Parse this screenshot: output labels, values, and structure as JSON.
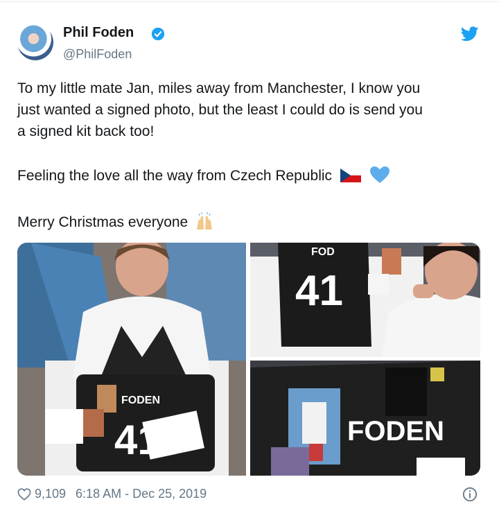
{
  "tweet": {
    "author_name": "Phil Foden",
    "author_handle": "@PhilFoden",
    "text_line_1": "To my little mate Jan, miles away from Manchester, I know you",
    "text_line_2": "just wanted a signed photo, but the least I could do is send you",
    "text_line_3": "a signed kit back too!",
    "text_line_4": "Feeling the love all the way from Czech Republic",
    "text_line_5": "Merry Christmas everyone",
    "media": {
      "shirt_name": "FODEN",
      "shirt_number": "41",
      "shirt_name_partial": "FOD"
    },
    "likes": "9,109",
    "timestamp": "6:18 AM - Dec 25, 2019"
  },
  "icons": {
    "verified": "verified-badge-icon",
    "twitter": "twitter-bird-icon",
    "like": "heart-outline-icon",
    "info": "info-icon",
    "flag": "czech-flag-icon",
    "blue_heart": "blue-heart-icon",
    "praise": "raising-hands-icon"
  },
  "colors": {
    "brand_blue": "#1da1f2",
    "text": "#14171a",
    "muted": "#657786"
  }
}
